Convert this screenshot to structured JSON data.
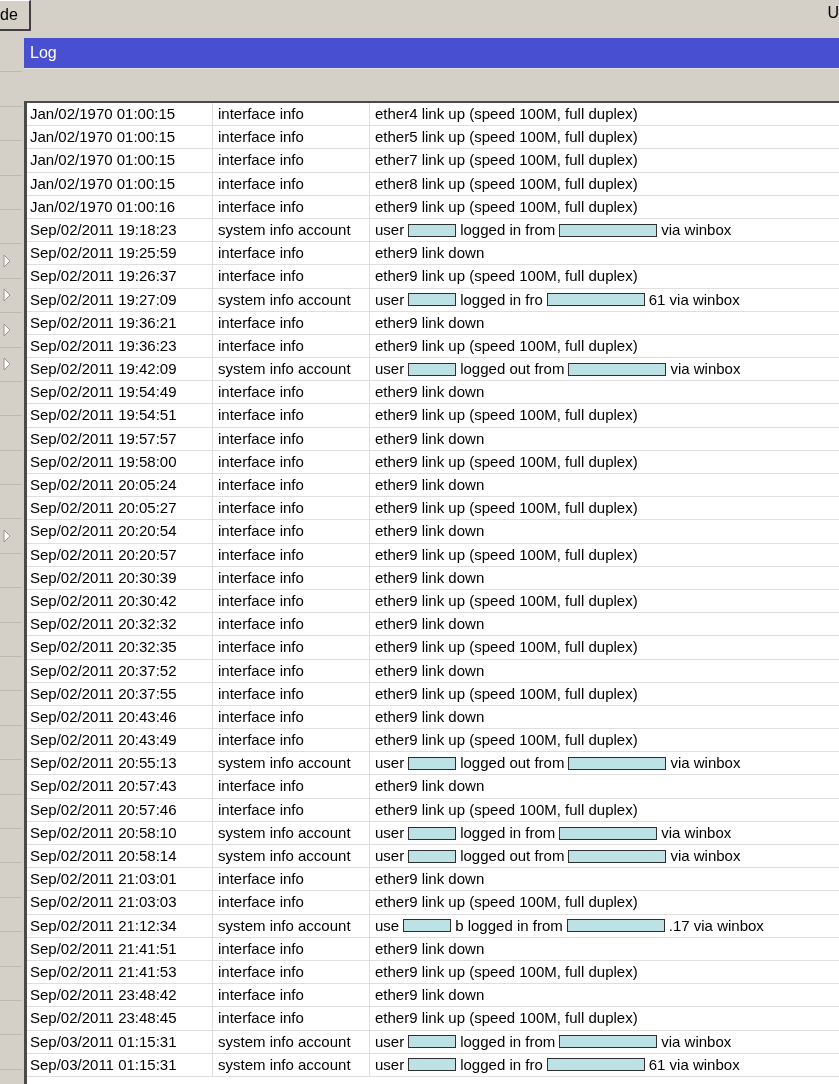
{
  "toolbar": {
    "button": {
      "label": "de"
    },
    "right_text": "U"
  },
  "sidebar": {
    "items": [
      {
        "submenu": false
      },
      {
        "submenu": false
      },
      {
        "submenu": false
      },
      {
        "submenu": false
      },
      {
        "submenu": false
      },
      {
        "submenu": false
      },
      {
        "submenu": true
      },
      {
        "submenu": true
      },
      {
        "submenu": true
      },
      {
        "submenu": true
      },
      {
        "submenu": false
      },
      {
        "submenu": false
      },
      {
        "submenu": false
      },
      {
        "submenu": false
      },
      {
        "submenu": true
      },
      {
        "submenu": false
      },
      {
        "submenu": false
      },
      {
        "submenu": false
      },
      {
        "submenu": false
      },
      {
        "submenu": false
      },
      {
        "submenu": false
      },
      {
        "submenu": false
      },
      {
        "submenu": false
      },
      {
        "submenu": false
      },
      {
        "submenu": false
      },
      {
        "submenu": false
      },
      {
        "submenu": false
      },
      {
        "submenu": false
      },
      {
        "submenu": false
      },
      {
        "submenu": false
      }
    ]
  },
  "window": {
    "title": "Log"
  },
  "table": {
    "rows": [
      {
        "column_1": "Jan/02/1970 01:00:15",
        "column_2": "interface info",
        "column_3": [
          {
            "kind": "text",
            "text": "ether4 link up (speed 100M, full duplex)"
          }
        ]
      },
      {
        "column_1": "Jan/02/1970 01:00:15",
        "column_2": "interface info",
        "column_3": [
          {
            "kind": "text",
            "text": "ether5 link up (speed 100M, full duplex)"
          }
        ]
      },
      {
        "column_1": "Jan/02/1970 01:00:15",
        "column_2": "interface info",
        "column_3": [
          {
            "kind": "text",
            "text": "ether7 link up (speed 100M, full duplex)"
          }
        ]
      },
      {
        "column_1": "Jan/02/1970 01:00:15",
        "column_2": "interface info",
        "column_3": [
          {
            "kind": "text",
            "text": "ether8 link up (speed 100M, full duplex)"
          }
        ]
      },
      {
        "column_1": "Jan/02/1970 01:00:16",
        "column_2": "interface info",
        "column_3": [
          {
            "kind": "text",
            "text": "ether9 link up (speed 100M, full duplex)"
          }
        ]
      },
      {
        "column_1": "Sep/02/2011 19:18:23",
        "column_2": "system info account",
        "column_3": [
          {
            "kind": "text",
            "text": "user"
          },
          {
            "kind": "redaction"
          },
          {
            "kind": "text",
            "text": "logged in from"
          },
          {
            "kind": "redaction"
          },
          {
            "kind": "text",
            "text": "via winbox"
          }
        ]
      },
      {
        "column_1": "Sep/02/2011 19:25:59",
        "column_2": "interface info",
        "column_3": [
          {
            "kind": "text",
            "text": "ether9 link down"
          }
        ]
      },
      {
        "column_1": "Sep/02/2011 19:26:37",
        "column_2": "interface info",
        "column_3": [
          {
            "kind": "text",
            "text": "ether9 link up (speed 100M, full duplex)"
          }
        ]
      },
      {
        "column_1": "Sep/02/2011 19:27:09",
        "column_2": "system info account",
        "column_3": [
          {
            "kind": "text",
            "text": "user"
          },
          {
            "kind": "redaction"
          },
          {
            "kind": "text",
            "text": "logged in fro"
          },
          {
            "kind": "redaction"
          },
          {
            "kind": "text",
            "text": "61 via winbox"
          }
        ]
      },
      {
        "column_1": "Sep/02/2011 19:36:21",
        "column_2": "interface info",
        "column_3": [
          {
            "kind": "text",
            "text": "ether9 link down"
          }
        ]
      },
      {
        "column_1": "Sep/02/2011 19:36:23",
        "column_2": "interface info",
        "column_3": [
          {
            "kind": "text",
            "text": "ether9 link up (speed 100M, full duplex)"
          }
        ]
      },
      {
        "column_1": "Sep/02/2011 19:42:09",
        "column_2": "system info account",
        "column_3": [
          {
            "kind": "text",
            "text": "user"
          },
          {
            "kind": "redaction"
          },
          {
            "kind": "text",
            "text": "logged out from"
          },
          {
            "kind": "redaction"
          },
          {
            "kind": "text",
            "text": "via winbox"
          }
        ]
      },
      {
        "column_1": "Sep/02/2011 19:54:49",
        "column_2": "interface info",
        "column_3": [
          {
            "kind": "text",
            "text": "ether9 link down"
          }
        ]
      },
      {
        "column_1": "Sep/02/2011 19:54:51",
        "column_2": "interface info",
        "column_3": [
          {
            "kind": "text",
            "text": "ether9 link up (speed 100M, full duplex)"
          }
        ]
      },
      {
        "column_1": "Sep/02/2011 19:57:57",
        "column_2": "interface info",
        "column_3": [
          {
            "kind": "text",
            "text": "ether9 link down"
          }
        ]
      },
      {
        "column_1": "Sep/02/2011 19:58:00",
        "column_2": "interface info",
        "column_3": [
          {
            "kind": "text",
            "text": "ether9 link up (speed 100M, full duplex)"
          }
        ]
      },
      {
        "column_1": "Sep/02/2011 20:05:24",
        "column_2": "interface info",
        "column_3": [
          {
            "kind": "text",
            "text": "ether9 link down"
          }
        ]
      },
      {
        "column_1": "Sep/02/2011 20:05:27",
        "column_2": "interface info",
        "column_3": [
          {
            "kind": "text",
            "text": "ether9 link up (speed 100M, full duplex)"
          }
        ]
      },
      {
        "column_1": "Sep/02/2011 20:20:54",
        "column_2": "interface info",
        "column_3": [
          {
            "kind": "text",
            "text": "ether9 link down"
          }
        ]
      },
      {
        "column_1": "Sep/02/2011 20:20:57",
        "column_2": "interface info",
        "column_3": [
          {
            "kind": "text",
            "text": "ether9 link up (speed 100M, full duplex)"
          }
        ]
      },
      {
        "column_1": "Sep/02/2011 20:30:39",
        "column_2": "interface info",
        "column_3": [
          {
            "kind": "text",
            "text": "ether9 link down"
          }
        ]
      },
      {
        "column_1": "Sep/02/2011 20:30:42",
        "column_2": "interface info",
        "column_3": [
          {
            "kind": "text",
            "text": "ether9 link up (speed 100M, full duplex)"
          }
        ]
      },
      {
        "column_1": "Sep/02/2011 20:32:32",
        "column_2": "interface info",
        "column_3": [
          {
            "kind": "text",
            "text": "ether9 link down"
          }
        ]
      },
      {
        "column_1": "Sep/02/2011 20:32:35",
        "column_2": "interface info",
        "column_3": [
          {
            "kind": "text",
            "text": "ether9 link up (speed 100M, full duplex)"
          }
        ]
      },
      {
        "column_1": "Sep/02/2011 20:37:52",
        "column_2": "interface info",
        "column_3": [
          {
            "kind": "text",
            "text": "ether9 link down"
          }
        ]
      },
      {
        "column_1": "Sep/02/2011 20:37:55",
        "column_2": "interface info",
        "column_3": [
          {
            "kind": "text",
            "text": "ether9 link up (speed 100M, full duplex)"
          }
        ]
      },
      {
        "column_1": "Sep/02/2011 20:43:46",
        "column_2": "interface info",
        "column_3": [
          {
            "kind": "text",
            "text": "ether9 link down"
          }
        ]
      },
      {
        "column_1": "Sep/02/2011 20:43:49",
        "column_2": "interface info",
        "column_3": [
          {
            "kind": "text",
            "text": "ether9 link up (speed 100M, full duplex)"
          }
        ]
      },
      {
        "column_1": "Sep/02/2011 20:55:13",
        "column_2": "system info account",
        "column_3": [
          {
            "kind": "text",
            "text": "user"
          },
          {
            "kind": "redaction"
          },
          {
            "kind": "text",
            "text": "logged out from"
          },
          {
            "kind": "redaction"
          },
          {
            "kind": "text",
            "text": "via winbox"
          }
        ]
      },
      {
        "column_1": "Sep/02/2011 20:57:43",
        "column_2": "interface info",
        "column_3": [
          {
            "kind": "text",
            "text": "ether9 link down"
          }
        ]
      },
      {
        "column_1": "Sep/02/2011 20:57:46",
        "column_2": "interface info",
        "column_3": [
          {
            "kind": "text",
            "text": "ether9 link up (speed 100M, full duplex)"
          }
        ]
      },
      {
        "column_1": "Sep/02/2011 20:58:10",
        "column_2": "system info account",
        "column_3": [
          {
            "kind": "text",
            "text": "user"
          },
          {
            "kind": "redaction"
          },
          {
            "kind": "text",
            "text": "logged in from"
          },
          {
            "kind": "redaction"
          },
          {
            "kind": "text",
            "text": "via winbox"
          }
        ]
      },
      {
        "column_1": "Sep/02/2011 20:58:14",
        "column_2": "system info account",
        "column_3": [
          {
            "kind": "text",
            "text": "user"
          },
          {
            "kind": "redaction"
          },
          {
            "kind": "text",
            "text": "logged out from"
          },
          {
            "kind": "redaction"
          },
          {
            "kind": "text",
            "text": "via winbox"
          }
        ]
      },
      {
        "column_1": "Sep/02/2011 21:03:01",
        "column_2": "interface info",
        "column_3": [
          {
            "kind": "text",
            "text": "ether9 link down"
          }
        ]
      },
      {
        "column_1": "Sep/02/2011 21:03:03",
        "column_2": "interface info",
        "column_3": [
          {
            "kind": "text",
            "text": "ether9 link up (speed 100M, full duplex)"
          }
        ]
      },
      {
        "column_1": "Sep/02/2011 21:12:34",
        "column_2": "system info account",
        "column_3": [
          {
            "kind": "text",
            "text": "use"
          },
          {
            "kind": "redaction"
          },
          {
            "kind": "text",
            "text": "b logged in from"
          },
          {
            "kind": "redaction"
          },
          {
            "kind": "text",
            "text": ".17 via winbox"
          }
        ]
      },
      {
        "column_1": "Sep/02/2011 21:41:51",
        "column_2": "interface info",
        "column_3": [
          {
            "kind": "text",
            "text": "ether9 link down"
          }
        ]
      },
      {
        "column_1": "Sep/02/2011 21:41:53",
        "column_2": "interface info",
        "column_3": [
          {
            "kind": "text",
            "text": "ether9 link up (speed 100M, full duplex)"
          }
        ]
      },
      {
        "column_1": "Sep/02/2011 23:48:42",
        "column_2": "interface info",
        "column_3": [
          {
            "kind": "text",
            "text": "ether9 link down"
          }
        ]
      },
      {
        "column_1": "Sep/02/2011 23:48:45",
        "column_2": "interface info",
        "column_3": [
          {
            "kind": "text",
            "text": "ether9 link up (speed 100M, full duplex)"
          }
        ]
      },
      {
        "column_1": "Sep/03/2011 01:15:31",
        "column_2": "system info account",
        "column_3": [
          {
            "kind": "text",
            "text": "user"
          },
          {
            "kind": "redaction"
          },
          {
            "kind": "text",
            "text": "logged in from"
          },
          {
            "kind": "redaction"
          },
          {
            "kind": "text",
            "text": "via winbox"
          }
        ]
      },
      {
        "column_1": "Sep/03/2011 01:15:31",
        "column_2": "system info account",
        "column_3": [
          {
            "kind": "text",
            "text": "user"
          },
          {
            "kind": "redaction"
          },
          {
            "kind": "text",
            "text": "logged in fro"
          },
          {
            "kind": "redaction"
          },
          {
            "kind": "text",
            "text": "61 via winbox"
          }
        ]
      }
    ]
  }
}
